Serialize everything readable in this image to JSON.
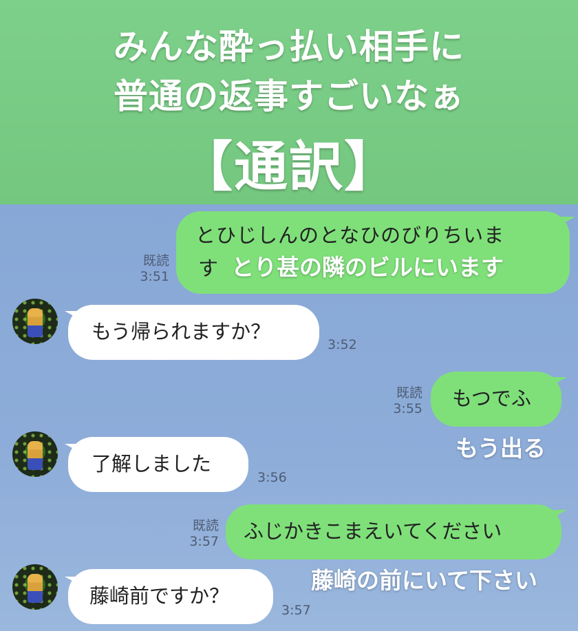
{
  "banner": {
    "line1": "みんな酔っ払い相手に",
    "line2": "普通の返事すごいなぁ",
    "line3": "【通訳】"
  },
  "messages": [
    {
      "direction": "outgoing",
      "text_line1": "とひじしんのとなひのびりちいま",
      "text_line2": "す",
      "translation": "とり甚の隣のビルにいます",
      "read": "既読",
      "time": "3:51"
    },
    {
      "direction": "incoming",
      "text": "もう帰られますか？",
      "time": "3:52"
    },
    {
      "direction": "outgoing",
      "text": "もつでふ",
      "translation": "もう出る",
      "read": "既読",
      "time": "3:55"
    },
    {
      "direction": "incoming",
      "text": "了解しました",
      "time": "3:56"
    },
    {
      "direction": "outgoing",
      "text": "ふじかきこまえいてください",
      "translation": "藤崎の前にいて下さい",
      "read": "既読",
      "time": "3:57"
    },
    {
      "direction": "incoming",
      "text": "藤崎前ですか？",
      "time": "3:57"
    }
  ],
  "colors": {
    "banner_green": "#7dd08a",
    "chat_bg": "#8aaad8",
    "outgoing_bubble": "#7fe07a",
    "incoming_bubble": "#ffffff"
  }
}
